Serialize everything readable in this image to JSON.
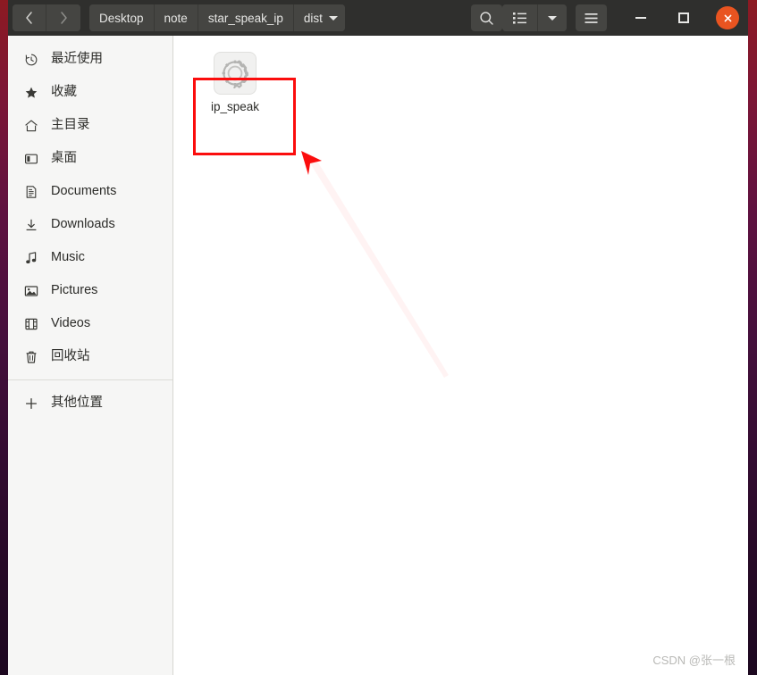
{
  "window": {
    "titlebar": {
      "nav": [
        {
          "name": "back",
          "icon": "chevron-left-icon",
          "label": "‹"
        },
        {
          "name": "forward",
          "icon": "chevron-right-icon",
          "label": "›"
        }
      ],
      "breadcrumbs": [
        {
          "label": "Desktop",
          "active": false
        },
        {
          "label": "note",
          "active": false
        },
        {
          "label": "star_speak_ip",
          "active": false
        },
        {
          "label": "dist",
          "active": true
        }
      ],
      "actions": [
        {
          "name": "search",
          "icon": "search-icon"
        },
        {
          "name": "view-list",
          "icon": "list-view-icon"
        },
        {
          "name": "view-options",
          "icon": "chevron-down-icon"
        },
        {
          "name": "main-menu",
          "icon": "hamburger-menu-icon"
        }
      ],
      "controls": [
        {
          "name": "minimize",
          "icon": "minimize-icon"
        },
        {
          "name": "maximize",
          "icon": "maximize-icon"
        },
        {
          "name": "close",
          "icon": "close-icon"
        }
      ]
    }
  },
  "sidebar": {
    "items": [
      {
        "label": "最近使用",
        "icon": "clock-history-icon"
      },
      {
        "label": "收藏",
        "icon": "star-icon"
      },
      {
        "label": "主目录",
        "icon": "home-icon"
      },
      {
        "label": "桌面",
        "icon": "desktop-icon"
      },
      {
        "label": "Documents",
        "icon": "document-icon"
      },
      {
        "label": "Downloads",
        "icon": "download-icon"
      },
      {
        "label": "Music",
        "icon": "music-note-icon"
      },
      {
        "label": "Pictures",
        "icon": "picture-icon"
      },
      {
        "label": "Videos",
        "icon": "video-film-icon"
      },
      {
        "label": "回收站",
        "icon": "trash-icon"
      }
    ],
    "other_locations": {
      "label": "其他位置",
      "icon": "plus-icon"
    }
  },
  "content": {
    "files": [
      {
        "name": "ip_speak",
        "icon": "gear-executable-icon"
      }
    ]
  },
  "annotations": {
    "highlight_color": "#fb0d0d",
    "rectangle": {
      "target": "ip_speak"
    },
    "arrow": {
      "points_to": "ip_speak"
    }
  },
  "watermark": {
    "text": "CSDN @张一根"
  },
  "colors": {
    "headerbar": "#2f2f2d",
    "sidebar": "#f6f6f5",
    "close_button": "#e95420",
    "annotation": "#fb0d0d"
  }
}
